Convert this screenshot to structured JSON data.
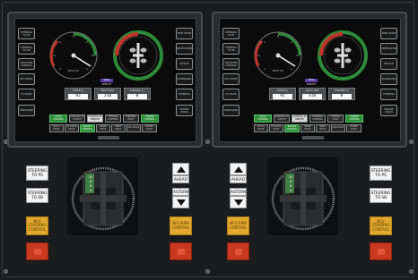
{
  "colors": {
    "panel": "#1b1c1d",
    "gauge_green": "#2e8b3a",
    "gauge_red": "#c0342a",
    "accent_purple": "#5b3fa6",
    "yellow_button": "#e2a92e",
    "red_button": "#c9391f",
    "status_green": "#2f8d3b"
  },
  "displays": [
    {
      "gauge_label": "PITCH [%]",
      "mode_label": "VMS1",
      "mode_status": "REMOTE",
      "readouts": [
        {
          "title": "PITCH[%]",
          "value": "92"
        },
        {
          "title": "SHAFT RPM",
          "value": "310"
        },
        {
          "title": "STEERING [°]",
          "value": "0"
        }
      ],
      "left_buttons": [
        "STEERING TO PS",
        "STEERING TO SB",
        "THRUSTER CONTROL",
        "NFU MODE",
        "FU MODE",
        "HARDWARE"
      ],
      "right_buttons": [
        "PORT MODE",
        "PROPULSION",
        "BRIDGE",
        "STARBOARD",
        "STEERING",
        "ENGINE ROOM"
      ],
      "status_row1": [
        {
          "label": "LOCAL CONTROL",
          "style": "green"
        },
        {
          "label": "CONTROL BY CLUTCH",
          "style": "grey"
        },
        {
          "label": "CONTROL IN REMOTE",
          "style": "white"
        },
        {
          "label": "STEERING CONTROL",
          "style": "grey"
        },
        {
          "label": "STEERING FAULT",
          "style": "grey"
        },
        {
          "label": "ENGINE CONTROL",
          "style": "green"
        }
      ],
      "status_row2": [
        {
          "label": "CS 1/2 FAULT",
          "style": "grey"
        },
        {
          "label": "PS LOCAL FAULT",
          "style": "grey"
        },
        {
          "label": "BACKUP CONTROL",
          "style": "green"
        },
        {
          "label": "SPARE FAULT",
          "style": "grey"
        },
        {
          "label": "INPUT FAULT",
          "style": "grey"
        },
        {
          "label": "DCS FAULT",
          "style": "grey"
        },
        {
          "label": "POWER FAULT",
          "style": "grey"
        }
      ]
    },
    {
      "gauge_label": "PITCH [%]",
      "mode_label": "VMS2",
      "mode_status": "REMOTE",
      "readouts": [
        {
          "title": "PITCH[%]",
          "value": "92"
        },
        {
          "title": "SHAFT RPM",
          "value": "310"
        },
        {
          "title": "STEERING [°]",
          "value": "0"
        }
      ],
      "left_buttons": [
        "STEERING TO PS",
        "STEERING TO SB",
        "THRUSTER CONTROL",
        "NFU MODE",
        "FU MODE",
        "HARDWARE"
      ],
      "right_buttons": [
        "PORT MODE",
        "PROPULSION",
        "BRIDGE",
        "STARBOARD",
        "STEERING",
        "ENGINE ROOM"
      ],
      "status_row1": [
        {
          "label": "LOCAL CONTROL",
          "style": "green"
        },
        {
          "label": "CONTROL BY CLUTCH",
          "style": "grey"
        },
        {
          "label": "CONTROL IN REMOTE",
          "style": "white"
        },
        {
          "label": "STEERING CONTROL",
          "style": "grey"
        },
        {
          "label": "STEERING FAULT",
          "style": "grey"
        },
        {
          "label": "ENGINE CONTROL",
          "style": "green"
        }
      ],
      "status_row2": [
        {
          "label": "CS 1/2 FAULT",
          "style": "grey"
        },
        {
          "label": "PS LOCAL FAULT",
          "style": "grey"
        },
        {
          "label": "BACKUP CONTROL",
          "style": "green"
        },
        {
          "label": "SPARE FAULT",
          "style": "grey"
        },
        {
          "label": "INPUT FAULT",
          "style": "grey"
        },
        {
          "label": "DCS FAULT",
          "style": "grey"
        },
        {
          "label": "POWER FAULT",
          "style": "grey"
        }
      ]
    }
  ],
  "controls_left": {
    "steering_to_ps": "STEERING TO PS",
    "steering_to_sb": "STEERING TO SB",
    "nfu_label": "NFU STEERING CONTROL",
    "ahead": "AHEAD",
    "astern": "ASTERN",
    "rpm_label": "NFU RPM CONTROL",
    "joystick_scale": [
      "10",
      "8",
      "6",
      "4"
    ]
  },
  "controls_right": {
    "ahead": "AHEAD",
    "astern": "ASTERN",
    "rpm_label": "NFU RPM CONTROL",
    "steering_to_ps": "STEERING TO PS",
    "steering_to_sb": "STEERING TO SB",
    "nfu_label": "NFU STEERING CONTROL",
    "joystick_scale": [
      "10",
      "8",
      "6",
      "4"
    ]
  }
}
